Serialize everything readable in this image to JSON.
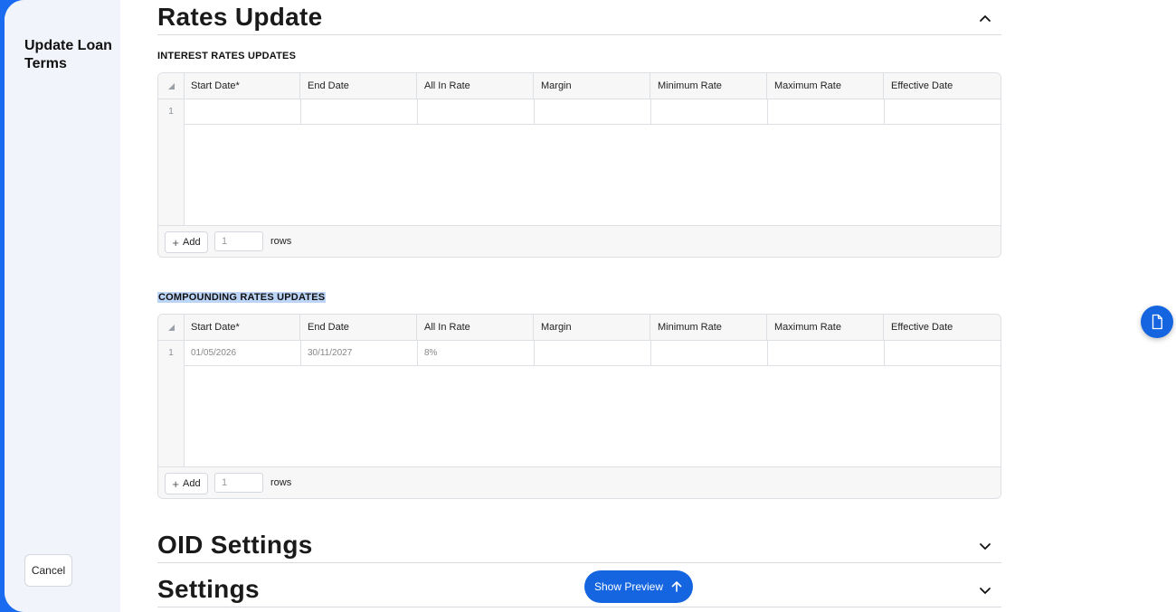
{
  "sidebar": {
    "title": "Update Loan Terms",
    "cancel_label": "Cancel"
  },
  "sections": {
    "rates": {
      "title": "Rates Update"
    },
    "oid": {
      "title": "OID Settings"
    },
    "settings": {
      "title": "Settings"
    }
  },
  "interest": {
    "heading": "INTEREST RATES UPDATES",
    "columns": [
      "Start Date*",
      "End Date",
      "All In Rate",
      "Margin",
      "Minimum Rate",
      "Maximum Rate",
      "Effective Date"
    ],
    "rows": [
      {
        "num": "1",
        "cells": [
          "",
          "",
          "",
          "",
          "",
          "",
          ""
        ]
      }
    ],
    "add_label": "Add",
    "rows_value": "1",
    "rows_label": "rows"
  },
  "compounding": {
    "heading": "COMPOUNDING RATES UPDATES",
    "columns": [
      "Start Date*",
      "End Date",
      "All In Rate",
      "Margin",
      "Minimum Rate",
      "Maximum Rate",
      "Effective Date"
    ],
    "rows": [
      {
        "num": "1",
        "cells": [
          "01/05/2026",
          "30/11/2027",
          "8%",
          "",
          "",
          "",
          ""
        ]
      }
    ],
    "add_label": "Add",
    "rows_value": "1",
    "rows_label": "rows"
  },
  "preview": {
    "label": "Show Preview"
  },
  "icons": {
    "collapse": "chevron-up-icon",
    "expand": "chevron-down-icon",
    "fab": "document-icon",
    "preview": "arrow-up-icon",
    "add": "plus-icon"
  },
  "colors": {
    "accent": "#1565e0",
    "highlight": "#bcd4f6"
  }
}
